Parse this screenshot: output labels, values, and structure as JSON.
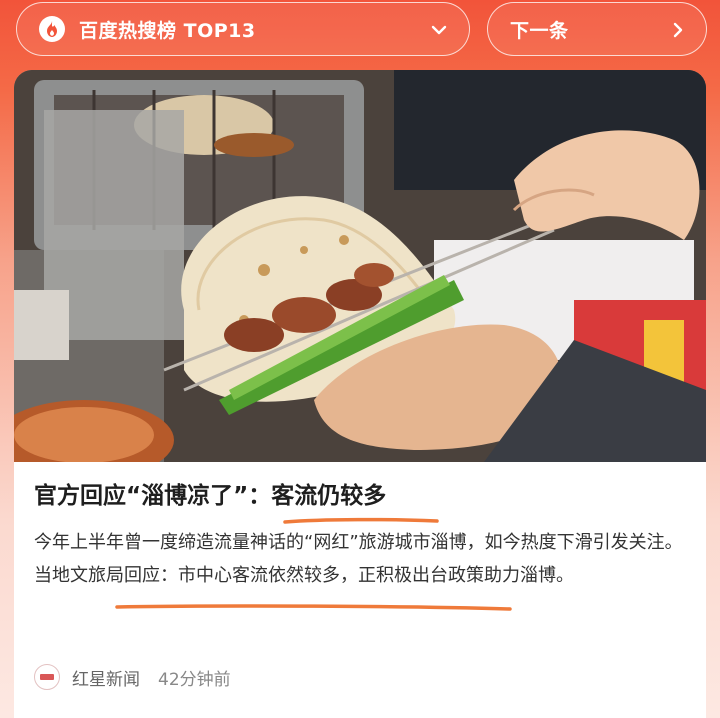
{
  "hot_list": {
    "label": "百度热搜榜 TOP13",
    "icon": "flame-icon",
    "dropdown_icon": "chevron-down-icon"
  },
  "next": {
    "label": "下一条",
    "icon": "chevron-right-icon"
  },
  "article": {
    "image_alt": "skewered lamb with scallion on flatbread",
    "headline": "官方回应“淄博凉了”：客流仍较多",
    "summary": "今年上半年曾一度缔造流量神话的“网红”旅游城市淄博，如今热度下滑引发关注。当地文旅局回应：市中心客流依然较多，正积极出台政策助力淄博。",
    "source_name": "红星新闻",
    "source_time": "42分钟前"
  },
  "colors": {
    "accent": "#f2543a",
    "underline": "#ef7a3a"
  }
}
